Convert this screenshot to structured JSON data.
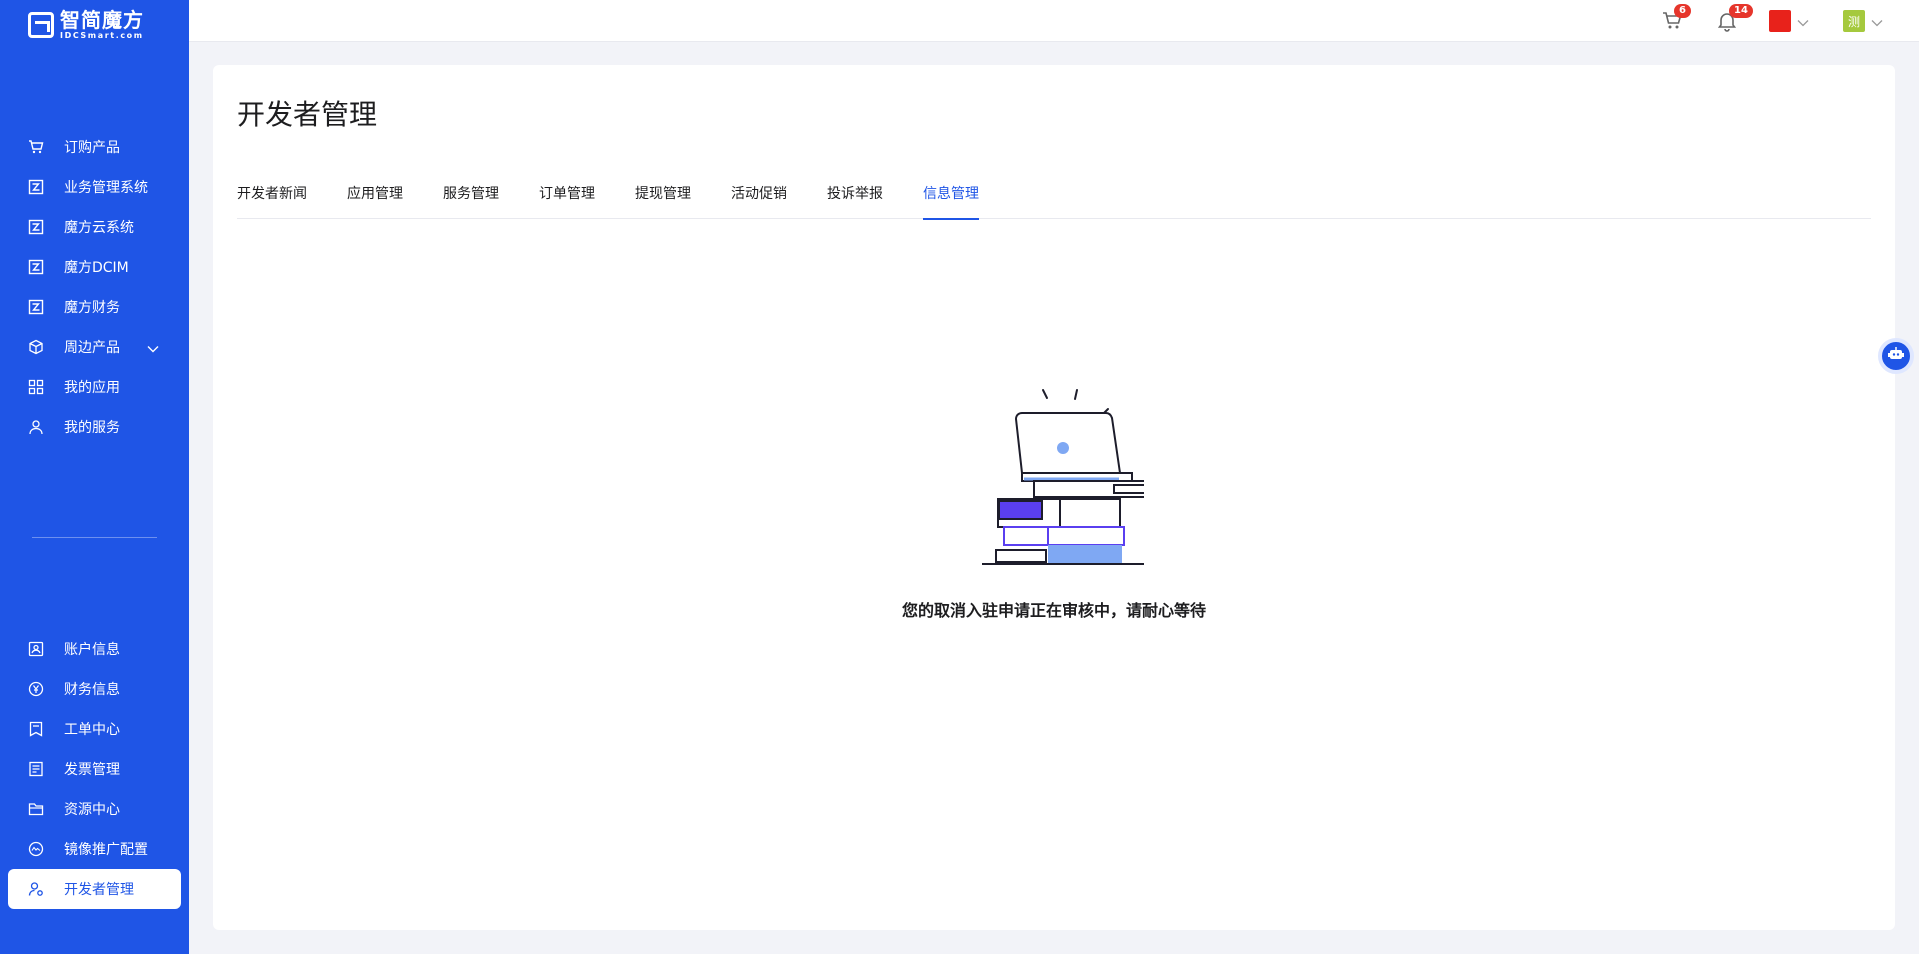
{
  "brand": {
    "name_cn": "智简魔方",
    "name_en": "IDCSmart.com"
  },
  "sidebar": {
    "top_items": [
      {
        "label": "订购产品",
        "icon": "cart-icon"
      },
      {
        "label": "业务管理系统",
        "icon": "logo-icon"
      },
      {
        "label": "魔方云系统",
        "icon": "logo-icon"
      },
      {
        "label": "魔方DCIM",
        "icon": "logo-icon"
      },
      {
        "label": "魔方财务",
        "icon": "logo-icon"
      },
      {
        "label": "周边产品",
        "icon": "cube-icon"
      },
      {
        "label": "我的应用",
        "icon": "grid-icon"
      },
      {
        "label": "我的服务",
        "icon": "user-icon"
      }
    ],
    "bottom_items": [
      {
        "label": "账户信息",
        "icon": "id-card-icon"
      },
      {
        "label": "财务信息",
        "icon": "yen-icon"
      },
      {
        "label": "工单中心",
        "icon": "ticket-icon"
      },
      {
        "label": "发票管理",
        "icon": "invoice-icon"
      },
      {
        "label": "资源中心",
        "icon": "folder-icon"
      },
      {
        "label": "镜像推广配置",
        "icon": "image-icon"
      },
      {
        "label": "开发者管理",
        "icon": "developer-icon"
      }
    ]
  },
  "topbar": {
    "cart_count": "6",
    "notification_count": "14",
    "avatar_text": "测"
  },
  "page": {
    "title": "开发者管理",
    "tabs": [
      "开发者新闻",
      "应用管理",
      "服务管理",
      "订单管理",
      "提现管理",
      "活动促销",
      "投诉举报",
      "信息管理"
    ],
    "active_tab": "信息管理",
    "empty_message": "您的取消入驻申请正在审核中，请耐心等待"
  },
  "colors": {
    "primary": "#1f55e6",
    "badge": "#e6352b",
    "flag": "#e8221b"
  }
}
